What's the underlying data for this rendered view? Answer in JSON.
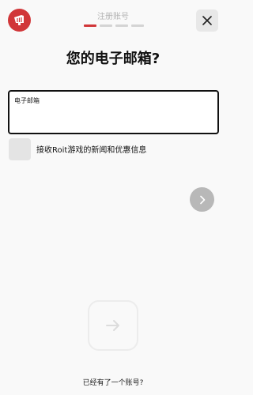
{
  "header": {
    "step_title": "注册账号",
    "steps_total": 4,
    "steps_active": 1
  },
  "main": {
    "headline": "您的电子邮箱?",
    "email_field": {
      "label": "电子邮箱",
      "value": ""
    },
    "newsletter_label": "接收Roit游戏的新闻和优惠信息"
  },
  "footer": {
    "have_account_link": "已经有了一个账号?"
  },
  "colors": {
    "brand_red": "#d13639",
    "background": "#f9f9f9",
    "inactive_button": "#b8b8b8"
  },
  "icons": [
    "riot-fist-logo-icon",
    "close-icon",
    "chevron-right-icon",
    "arrow-right-icon"
  ]
}
